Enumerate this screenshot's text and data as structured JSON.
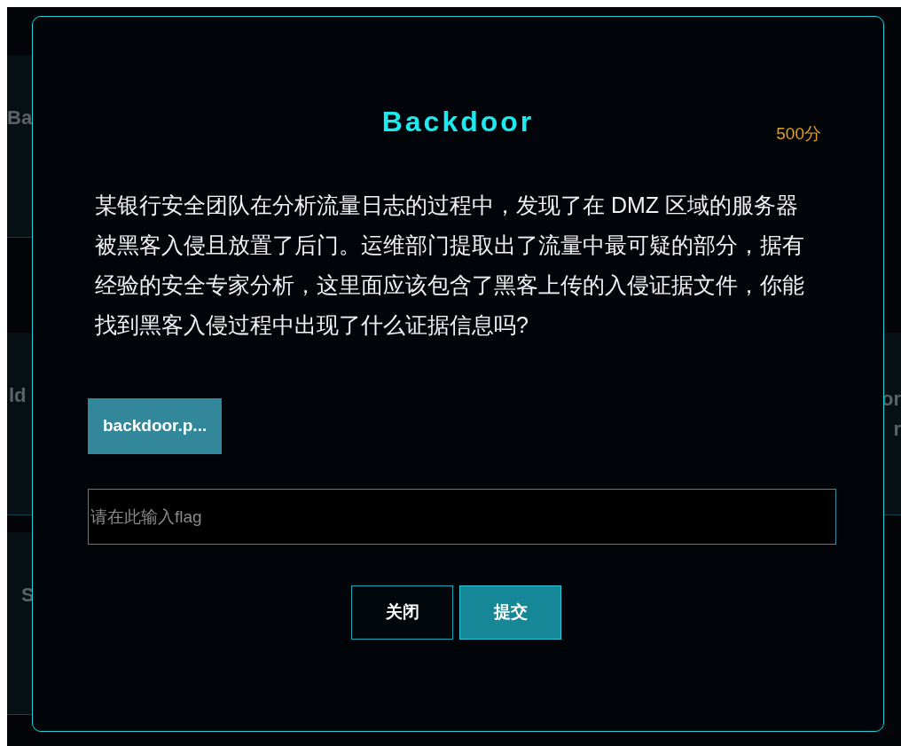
{
  "left_cards": [
    {
      "texts": [
        "Ba"
      ]
    },
    {
      "texts": [
        "ld"
      ]
    },
    {
      "texts": [
        "S"
      ]
    }
  ],
  "right_cards": [
    {
      "texts": [
        "or",
        "r"
      ]
    }
  ],
  "dialog": {
    "title": "Backdoor",
    "score": "500分",
    "description": "某银行安全团队在分析流量日志的过程中，发现了在 DMZ 区域的服务器被黑客入侵且放置了后门。运维部门提取出了流量中最可疑的部分，据有经验的安全专家分析，这里面应该包含了黑客上传的入侵证据文件，你能找到黑客入侵过程中出现了什么证据信息吗?",
    "attachment": "backdoor.p...",
    "flag_field": {
      "placeholder": "请在此输入flag"
    },
    "buttons": [
      {
        "label": "关闭",
        "kind": "secondary"
      },
      {
        "label": "提交",
        "kind": "primary"
      }
    ]
  }
}
